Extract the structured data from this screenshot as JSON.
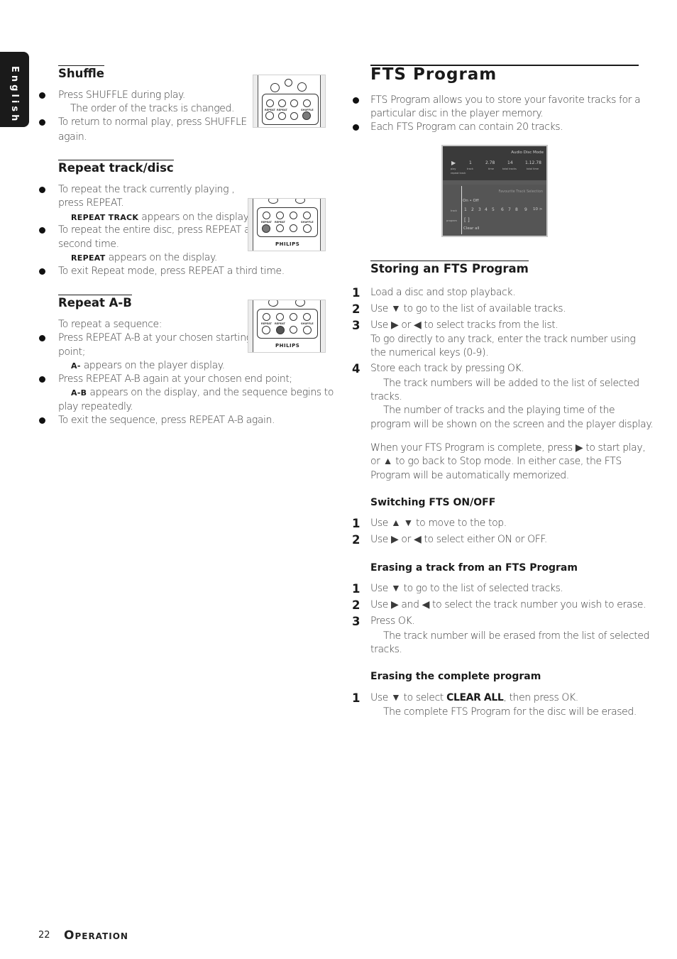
{
  "language_tab": "English",
  "footer": {
    "page_number": "22",
    "section_title_first": "O",
    "section_title_rest": "PERATION"
  },
  "left": {
    "shuffle": {
      "heading": "Shuffle",
      "lines": [
        "Press SHUFFLE during play.",
        "The order of the tracks is changed.",
        "To return to normal play, press SHUFFLE",
        "again."
      ]
    },
    "repeat_track": {
      "heading": "Repeat track/disc",
      "lines": [
        "To repeat the track currently playing ,",
        "press REPEAT.",
        "REPEAT TRACK",
        " appears on the display.",
        "To repeat the entire disc, press REPEAT a",
        "second time.",
        "REPEAT",
        " appears on the display.",
        "To exit Repeat mode, press REPEAT a third time."
      ]
    },
    "repeat_ab": {
      "heading": "Repeat A-B",
      "lines": [
        "To repeat a sequence:",
        "Press REPEAT A-B at your chosen starting",
        "point;",
        "A-",
        " appears on the player display.",
        "Press REPEAT A-B again at your chosen end point;",
        "A-B",
        " appears on the display, and the sequence begins to",
        "play repeatedly.",
        "To exit the sequence, press REPEAT A-B again."
      ]
    },
    "remote": {
      "brand": "PHILIPS",
      "labels": {
        "repeat": "REPEAT",
        "repeat2": "REPEAT",
        "shuffle": "SHUFFLE"
      }
    }
  },
  "right": {
    "title": "FTS Program",
    "intro": [
      "FTS Program allows you to store your favorite tracks for a",
      "particular disc in the player memory.",
      "Each FTS Program can contain 20 tracks."
    ],
    "screen": {
      "mode": "Audio Disc Mode",
      "play_label": "play",
      "repeat_label": "repeat track",
      "track_value": "1",
      "track_label": "track",
      "time_value": "2.78",
      "time_label": "time",
      "total_tracks_value": "14",
      "total_tracks_label": "total tracks",
      "total_time_value": "1.12.78",
      "total_time_label": "total time",
      "selection_title": "Favourite Track Selection",
      "on_off": "On • Off",
      "track_row_label": "track",
      "tracks": [
        "1",
        "2",
        "3",
        "4",
        "5",
        "6",
        "7",
        "8",
        "9",
        "10 >"
      ],
      "program_row_label": "program",
      "program_value": "[ ]",
      "clear_all": "Clear all"
    },
    "storing": {
      "heading": "Storing an FTS Program",
      "steps": [
        {
          "n": "1",
          "text": "Load a disc and stop playback."
        },
        {
          "n": "2",
          "text": "Use ▼ to go to the list of available tracks."
        },
        {
          "n": "3",
          "text": "Use ▶ or ◀ to select tracks from the list."
        },
        {
          "n": "",
          "text": "To go directly to any track, enter the track number using"
        },
        {
          "n": "",
          "text": "the numerical keys (0-9)."
        },
        {
          "n": "4",
          "text": "Store each track by pressing OK."
        }
      ],
      "notes": [
        "The track numbers will be added to the list of selected",
        "tracks.",
        "The number of tracks and the playing time of the",
        "program will be shown on the screen and the player display."
      ],
      "paragraph": [
        "When your FTS Program is complete, press ▶ to start play,",
        "or ▲ to go back to Stop mode. In either case, the FTS",
        "Program will be automatically memorized."
      ]
    },
    "switching": {
      "heading": "Switching FTS ON/OFF",
      "steps": [
        {
          "n": "1",
          "text": "Use ▲ ▼ to move to the top."
        },
        {
          "n": "2",
          "text": "Use ▶ or ◀ to select either ON or OFF."
        }
      ]
    },
    "erasing_track": {
      "heading": "Erasing a track from an FTS Program",
      "steps": [
        {
          "n": "1",
          "text": "Use ▼ to go to the list of selected tracks."
        },
        {
          "n": "2",
          "text": "Use ▶ and ◀ to select the track number you wish to erase."
        },
        {
          "n": "3",
          "text": "Press OK."
        }
      ],
      "notes": [
        "The track number will be erased from the list of selected",
        "tracks."
      ]
    },
    "erasing_all": {
      "heading": "Erasing the complete program",
      "step_n": "1",
      "step_pre": "Use ▼ to select ",
      "step_bold": "CLEAR ALL",
      "step_post": ", then press OK.",
      "note": "The complete FTS Program for the disc will be erased."
    }
  }
}
